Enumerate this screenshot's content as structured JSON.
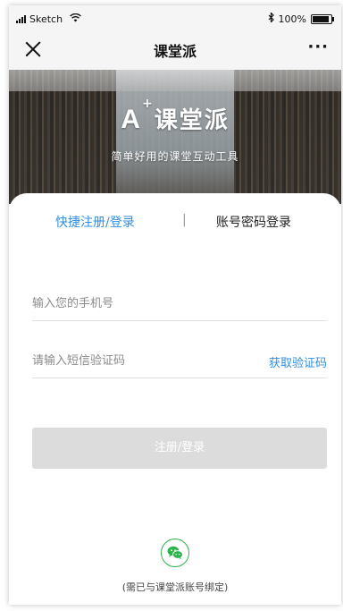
{
  "status_bar": {
    "carrier": "Sketch",
    "battery_text": "100%",
    "battery_level": 1.0,
    "icons": [
      "signal-icon",
      "wifi-icon",
      "bluetooth-icon",
      "battery-icon"
    ]
  },
  "nav": {
    "title": "课堂派",
    "close_icon": "close-icon",
    "more_label": "···"
  },
  "hero": {
    "logo_text": "课堂派",
    "logo_mark": "A",
    "logo_plus": "+",
    "tagline": "简单好用的课堂互动工具"
  },
  "tabs": {
    "quick_label": "快捷注册/登录",
    "divider": "|",
    "password_label": "账号密码登录",
    "active": "quick"
  },
  "form": {
    "phone_placeholder": "输入您的手机号",
    "code_placeholder": "请输入短信验证码",
    "get_code_label": "获取验证码",
    "submit_label": "注册/登录"
  },
  "wechat": {
    "icon": "wechat-icon",
    "note": "(需已与课堂派账号绑定)"
  },
  "colors": {
    "accent": "#2f8fe0",
    "wechat_green": "#2db44a",
    "button_disabled": "#dcdcdc"
  }
}
